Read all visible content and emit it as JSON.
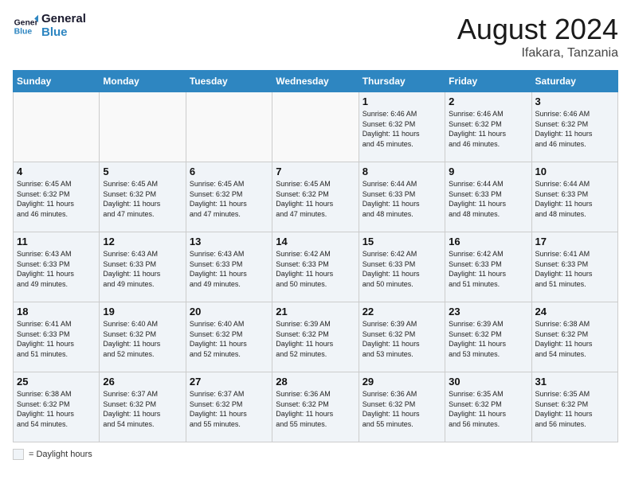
{
  "header": {
    "logo_line1": "General",
    "logo_line2": "Blue",
    "month_year": "August 2024",
    "location": "Ifakara, Tanzania"
  },
  "weekdays": [
    "Sunday",
    "Monday",
    "Tuesday",
    "Wednesday",
    "Thursday",
    "Friday",
    "Saturday"
  ],
  "weeks": [
    [
      {
        "day": "",
        "text": ""
      },
      {
        "day": "",
        "text": ""
      },
      {
        "day": "",
        "text": ""
      },
      {
        "day": "",
        "text": ""
      },
      {
        "day": "1",
        "text": "Sunrise: 6:46 AM\nSunset: 6:32 PM\nDaylight: 11 hours\nand 45 minutes."
      },
      {
        "day": "2",
        "text": "Sunrise: 6:46 AM\nSunset: 6:32 PM\nDaylight: 11 hours\nand 46 minutes."
      },
      {
        "day": "3",
        "text": "Sunrise: 6:46 AM\nSunset: 6:32 PM\nDaylight: 11 hours\nand 46 minutes."
      }
    ],
    [
      {
        "day": "4",
        "text": "Sunrise: 6:45 AM\nSunset: 6:32 PM\nDaylight: 11 hours\nand 46 minutes."
      },
      {
        "day": "5",
        "text": "Sunrise: 6:45 AM\nSunset: 6:32 PM\nDaylight: 11 hours\nand 47 minutes."
      },
      {
        "day": "6",
        "text": "Sunrise: 6:45 AM\nSunset: 6:32 PM\nDaylight: 11 hours\nand 47 minutes."
      },
      {
        "day": "7",
        "text": "Sunrise: 6:45 AM\nSunset: 6:32 PM\nDaylight: 11 hours\nand 47 minutes."
      },
      {
        "day": "8",
        "text": "Sunrise: 6:44 AM\nSunset: 6:33 PM\nDaylight: 11 hours\nand 48 minutes."
      },
      {
        "day": "9",
        "text": "Sunrise: 6:44 AM\nSunset: 6:33 PM\nDaylight: 11 hours\nand 48 minutes."
      },
      {
        "day": "10",
        "text": "Sunrise: 6:44 AM\nSunset: 6:33 PM\nDaylight: 11 hours\nand 48 minutes."
      }
    ],
    [
      {
        "day": "11",
        "text": "Sunrise: 6:43 AM\nSunset: 6:33 PM\nDaylight: 11 hours\nand 49 minutes."
      },
      {
        "day": "12",
        "text": "Sunrise: 6:43 AM\nSunset: 6:33 PM\nDaylight: 11 hours\nand 49 minutes."
      },
      {
        "day": "13",
        "text": "Sunrise: 6:43 AM\nSunset: 6:33 PM\nDaylight: 11 hours\nand 49 minutes."
      },
      {
        "day": "14",
        "text": "Sunrise: 6:42 AM\nSunset: 6:33 PM\nDaylight: 11 hours\nand 50 minutes."
      },
      {
        "day": "15",
        "text": "Sunrise: 6:42 AM\nSunset: 6:33 PM\nDaylight: 11 hours\nand 50 minutes."
      },
      {
        "day": "16",
        "text": "Sunrise: 6:42 AM\nSunset: 6:33 PM\nDaylight: 11 hours\nand 51 minutes."
      },
      {
        "day": "17",
        "text": "Sunrise: 6:41 AM\nSunset: 6:33 PM\nDaylight: 11 hours\nand 51 minutes."
      }
    ],
    [
      {
        "day": "18",
        "text": "Sunrise: 6:41 AM\nSunset: 6:33 PM\nDaylight: 11 hours\nand 51 minutes."
      },
      {
        "day": "19",
        "text": "Sunrise: 6:40 AM\nSunset: 6:32 PM\nDaylight: 11 hours\nand 52 minutes."
      },
      {
        "day": "20",
        "text": "Sunrise: 6:40 AM\nSunset: 6:32 PM\nDaylight: 11 hours\nand 52 minutes."
      },
      {
        "day": "21",
        "text": "Sunrise: 6:39 AM\nSunset: 6:32 PM\nDaylight: 11 hours\nand 52 minutes."
      },
      {
        "day": "22",
        "text": "Sunrise: 6:39 AM\nSunset: 6:32 PM\nDaylight: 11 hours\nand 53 minutes."
      },
      {
        "day": "23",
        "text": "Sunrise: 6:39 AM\nSunset: 6:32 PM\nDaylight: 11 hours\nand 53 minutes."
      },
      {
        "day": "24",
        "text": "Sunrise: 6:38 AM\nSunset: 6:32 PM\nDaylight: 11 hours\nand 54 minutes."
      }
    ],
    [
      {
        "day": "25",
        "text": "Sunrise: 6:38 AM\nSunset: 6:32 PM\nDaylight: 11 hours\nand 54 minutes."
      },
      {
        "day": "26",
        "text": "Sunrise: 6:37 AM\nSunset: 6:32 PM\nDaylight: 11 hours\nand 54 minutes."
      },
      {
        "day": "27",
        "text": "Sunrise: 6:37 AM\nSunset: 6:32 PM\nDaylight: 11 hours\nand 55 minutes."
      },
      {
        "day": "28",
        "text": "Sunrise: 6:36 AM\nSunset: 6:32 PM\nDaylight: 11 hours\nand 55 minutes."
      },
      {
        "day": "29",
        "text": "Sunrise: 6:36 AM\nSunset: 6:32 PM\nDaylight: 11 hours\nand 55 minutes."
      },
      {
        "day": "30",
        "text": "Sunrise: 6:35 AM\nSunset: 6:32 PM\nDaylight: 11 hours\nand 56 minutes."
      },
      {
        "day": "31",
        "text": "Sunrise: 6:35 AM\nSunset: 6:32 PM\nDaylight: 11 hours\nand 56 minutes."
      }
    ]
  ],
  "legend": {
    "box_label": "= Daylight hours"
  }
}
